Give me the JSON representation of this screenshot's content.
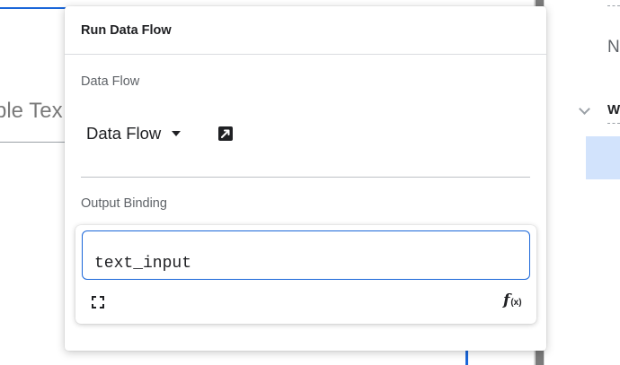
{
  "background": {
    "sample_text_fragment": "ple Tex"
  },
  "right_panel": {
    "partial_letter_n": "N",
    "partial_letter_w": "W"
  },
  "popover": {
    "title": "Run Data Flow",
    "data_flow": {
      "label": "Data Flow",
      "selected_value": "Data Flow",
      "dropdown_icon": "caret-down-icon",
      "open_icon": "open-in-new-icon"
    },
    "output_binding": {
      "label": "Output Binding",
      "value": "text_input",
      "expand_icon": "expand-icon",
      "function_icon": "fx-icon"
    }
  },
  "colors": {
    "accent": "#1a66d9",
    "selected_row": "#d2e3fc",
    "label_gray": "#5f6368",
    "scrollbar_thumb": "#7b7b7b"
  }
}
